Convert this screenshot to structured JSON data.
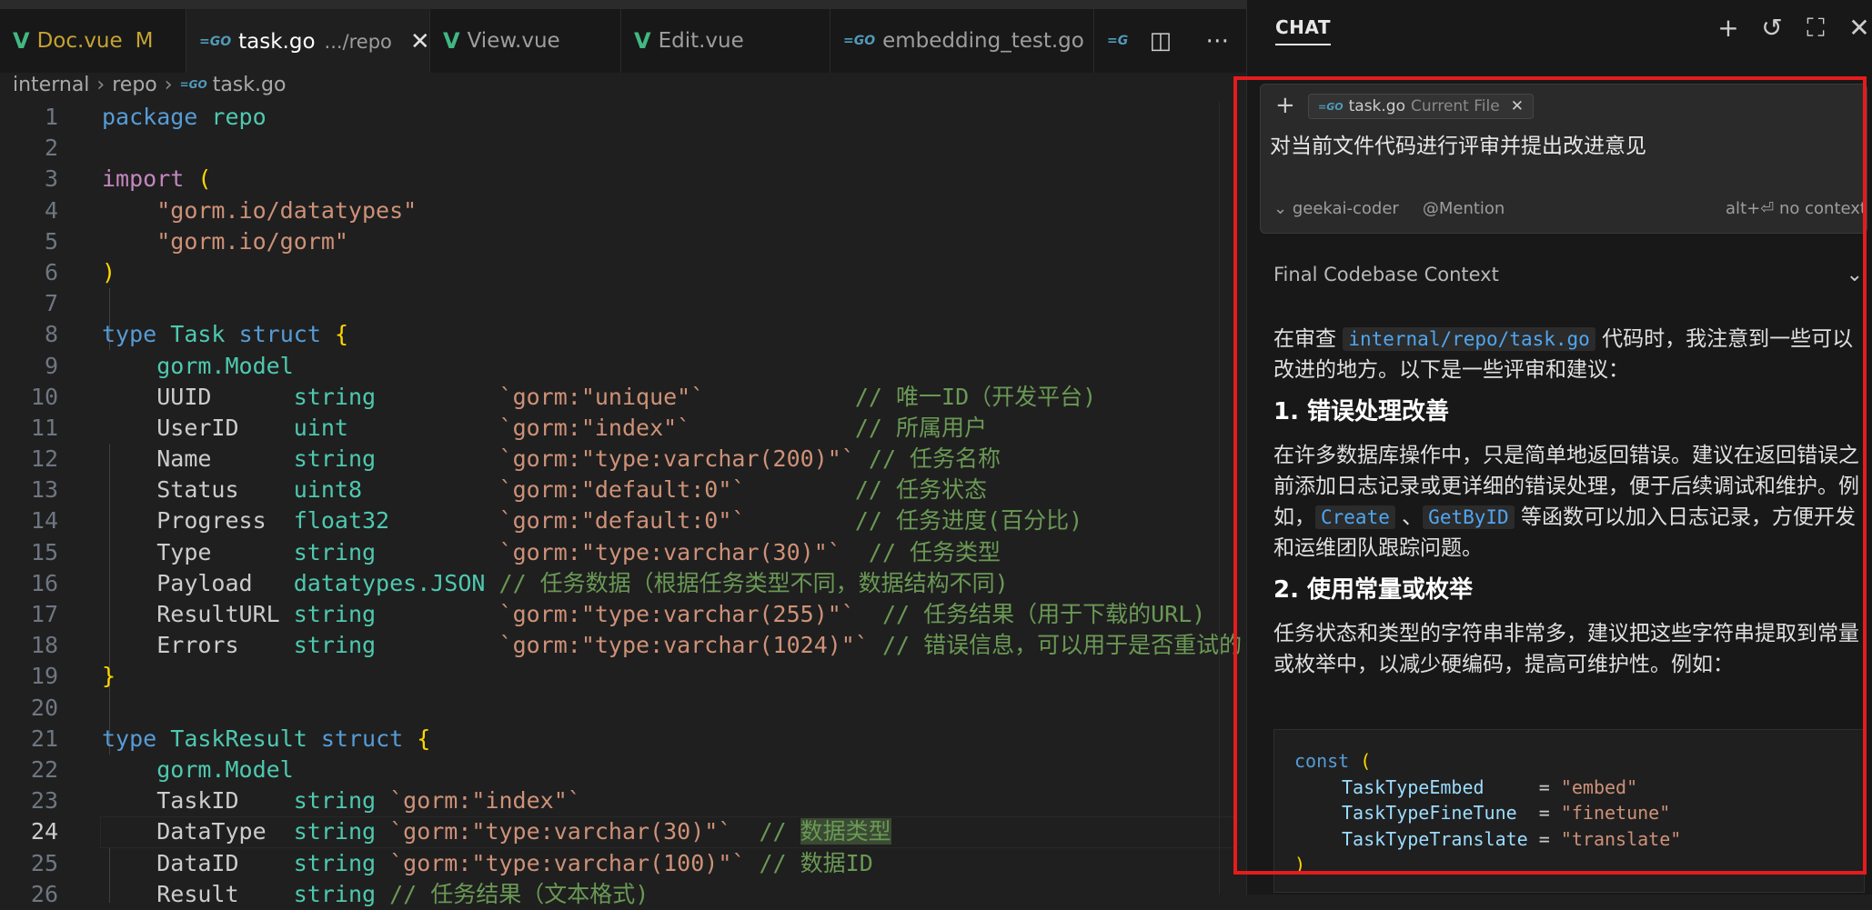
{
  "tabs": [
    {
      "label": "Doc.vue",
      "icon": "vue-icon",
      "modified": "M"
    },
    {
      "label": "task.go",
      "icon": "go-icon",
      "description": ".../repo",
      "close": "✕",
      "active": true
    },
    {
      "label": "View.vue",
      "icon": "vue-icon"
    },
    {
      "label": "Edit.vue",
      "icon": "vue-icon"
    },
    {
      "label": "embedding_test.go",
      "icon": "go-icon"
    }
  ],
  "tab_actions": [
    "split-editor-icon",
    "more-actions-icon"
  ],
  "breadcrumb": [
    "internal",
    "repo",
    "task.go"
  ],
  "code_lines": [
    {
      "n": "1"
    },
    {
      "n": "2"
    },
    {
      "n": "3"
    },
    {
      "n": "4"
    },
    {
      "n": "5"
    },
    {
      "n": "6"
    },
    {
      "n": "7"
    },
    {
      "n": "8"
    },
    {
      "n": "9"
    },
    {
      "n": "10"
    },
    {
      "n": "11"
    },
    {
      "n": "12"
    },
    {
      "n": "13"
    },
    {
      "n": "14"
    },
    {
      "n": "15"
    },
    {
      "n": "16"
    },
    {
      "n": "17"
    },
    {
      "n": "18"
    },
    {
      "n": "19"
    },
    {
      "n": "20"
    },
    {
      "n": "21"
    },
    {
      "n": "22"
    },
    {
      "n": "23"
    },
    {
      "n": "24"
    },
    {
      "n": "25"
    },
    {
      "n": "26"
    }
  ],
  "code": {
    "l1": [
      "package",
      "repo"
    ],
    "l3": [
      "import",
      "("
    ],
    "l4": "\"gorm.io/datatypes\"",
    "l5": "\"gorm.io/gorm\"",
    "l6": ")",
    "l8": [
      "type",
      "Task",
      "struct",
      "{"
    ],
    "l9": "gorm.Model",
    "l10": [
      "UUID      ",
      "string         ",
      "`gorm:\"unique\"`           ",
      "// 唯一ID（开发平台)"
    ],
    "l11": [
      "UserID    ",
      "uint           ",
      "`gorm:\"index\"`            ",
      "// 所属用户"
    ],
    "l12": [
      "Name      ",
      "string         ",
      "`gorm:\"type:varchar(200)\"` ",
      "// 任务名称"
    ],
    "l13": [
      "Status    ",
      "uint8          ",
      "`gorm:\"default:0\"`        ",
      "// 任务状态"
    ],
    "l14": [
      "Progress  ",
      "float32        ",
      "`gorm:\"default:0\"`        ",
      "// 任务进度(百分比)"
    ],
    "l15": [
      "Type      ",
      "string         ",
      "`gorm:\"type:varchar(30)\"`  ",
      "// 任务类型"
    ],
    "l16": [
      "Payload   ",
      "datatypes.JSON ",
      "// 任务数据（根据任务类型不同，数据结构不同)"
    ],
    "l17": [
      "ResultURL ",
      "string         ",
      "`gorm:\"type:varchar(255)\"`  ",
      "// 任务结果（用于下载的URL)"
    ],
    "l18": [
      "Errors    ",
      "string         ",
      "`gorm:\"type:varchar(1024)\"` ",
      "// 错误信息，可以用于是否重试的"
    ],
    "l19": "}",
    "l21": [
      "type",
      "TaskResult",
      "struct",
      "{"
    ],
    "l22": "gorm.Model",
    "l23": [
      "TaskID    ",
      "string ",
      "`gorm:\"index\"`"
    ],
    "l24": [
      "DataType  ",
      "string ",
      "`gorm:\"type:varchar(30)\"`  ",
      "// ",
      "数据类型"
    ],
    "l25": [
      "DataID    ",
      "string ",
      "`gorm:\"type:varchar(100)\"` ",
      "// 数据ID"
    ],
    "l26": [
      "Result    ",
      "string ",
      "// 任务结果（文本格式)"
    ]
  },
  "chat": {
    "title": "CHAT",
    "header_icons": [
      "add-icon",
      "history-icon",
      "maximize-icon",
      "close-icon"
    ],
    "input": {
      "plus": "+",
      "chip_file": "task.go",
      "chip_label": "Current File",
      "chip_close": "✕",
      "prompt": "对当前文件代码进行评审并提出改进意见",
      "model": "geekai-coder",
      "mention": "@Mention",
      "hint": "alt+⏎ no context"
    },
    "context_label": "Final Codebase Context",
    "answer": {
      "p1_before": "在审查 ",
      "p1_code": "internal/repo/task.go",
      "p1_after": " 代码时，我注意到一些可以改进的地方。以下是一些评审和建议：",
      "h1": "1. 错误处理改善",
      "p2_before": "在许多数据库操作中，只是简单地返回错误。建议在返回错误之前添加日志记录或更详细的错误处理，便于后续调试和维护。例如，",
      "p2_code1": "Create",
      "p2_sep": " 、",
      "p2_code2": "GetByID",
      "p2_after": " 等函数可以加入日志记录，方便开发和运维团队跟踪问题。",
      "h2": "2. 使用常量或枚举",
      "p3": "任务状态和类型的字符串非常多，建议把这些字符串提取到常量或枚举中，以减少硬编码，提高可维护性。例如："
    },
    "code_block": {
      "l1_kw": "const",
      "l1_br": "(",
      "rows": [
        {
          "name": "TaskTypeEmbed    ",
          "eq": "= ",
          "val": "\"embed\""
        },
        {
          "name": "TaskTypeFineTune ",
          "eq": "= ",
          "val": "\"finetune\""
        },
        {
          "name": "TaskTypeTranslate",
          "eq": " = ",
          "val": "\"translate\""
        }
      ],
      "close": ")"
    }
  }
}
